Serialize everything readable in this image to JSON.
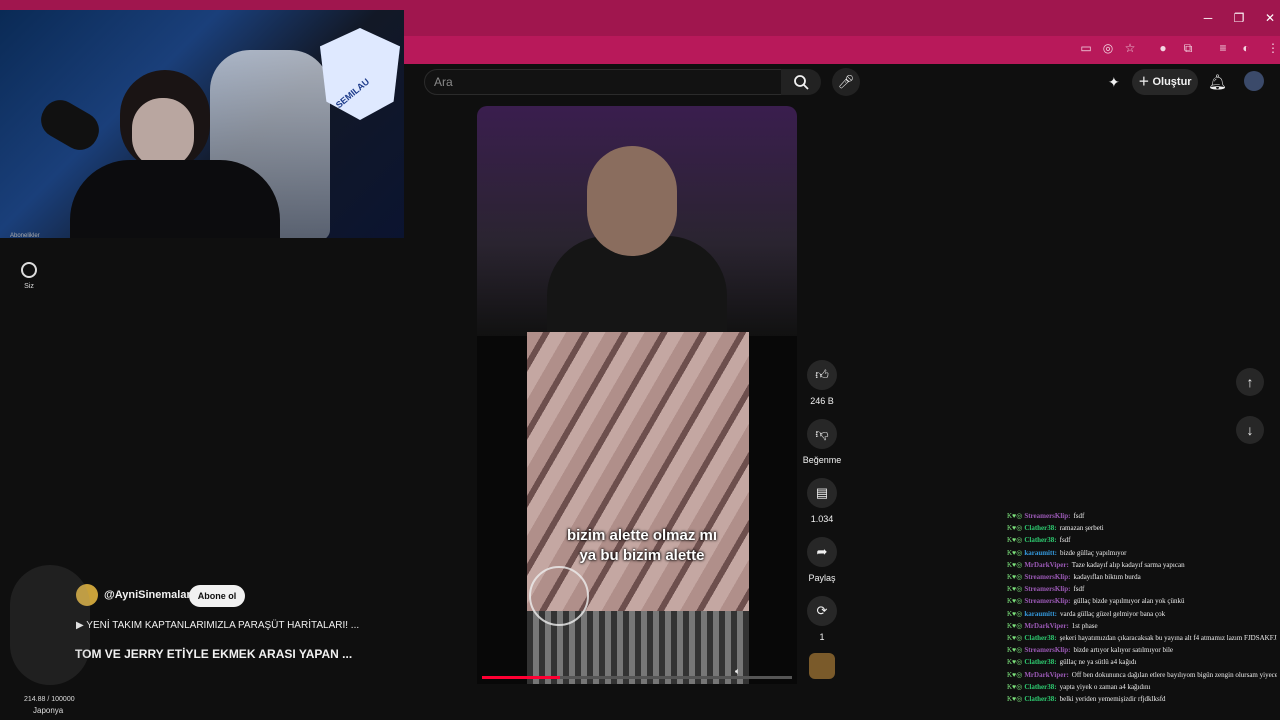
{
  "window": {
    "minimize": "─",
    "restore": "❐",
    "close": "✕"
  },
  "webcam": {
    "logo_text": "SEMILAU"
  },
  "sidebar": {
    "top_label": "Abonelikler",
    "you_label": "Siz"
  },
  "header": {
    "search_placeholder": "Ara",
    "create_label": "Oluştur"
  },
  "video": {
    "caption_line1": "bizim alette olmaz mı",
    "caption_line2": "ya bu bizim alette",
    "progress_pct": 25
  },
  "actions": {
    "likes": "246 B",
    "dislike_label": "Beğenme",
    "comments": "1.034",
    "share_label": "Paylaş",
    "remix_count": "1"
  },
  "channel": {
    "handle": "@AyniSinemalar",
    "subscribe_label": "Abone ol",
    "playlist": "YENİ TAKIM KAPTANLARIMIZLA PARAŞÜT HARİTALARI! ...",
    "title": "TOM VE JERRY ETİYLE EKMEK ARASI YAPAN ..."
  },
  "overlay": {
    "counter": "214.88 / 100000",
    "country": "Japonya"
  },
  "chat": [
    {
      "user": "StreamersKlip",
      "color": "#9b59b6",
      "msg": "fsdf"
    },
    {
      "user": "Clather38",
      "color": "#2ecc71",
      "msg": "ramazan şerbeti"
    },
    {
      "user": "Clather38",
      "color": "#2ecc71",
      "msg": "fsdf"
    },
    {
      "user": "karaumitt",
      "color": "#3498db",
      "msg": "bizde güllaç yapılmıyor"
    },
    {
      "user": "MrDarkViper",
      "color": "#9b59b6",
      "msg": "Taze kadayıf alıp kadayıf sarma yapıcan"
    },
    {
      "user": "StreamersKlip",
      "color": "#9b59b6",
      "msg": "kadayıflan biktım burda"
    },
    {
      "user": "StreamersKlip",
      "color": "#9b59b6",
      "msg": "fsdf"
    },
    {
      "user": "StreamersKlip",
      "color": "#9b59b6",
      "msg": "güllaç bizde yapılmıyor alan yok çünkü"
    },
    {
      "user": "karaumitt",
      "color": "#3498db",
      "msg": "varda güllaç güzel gelmiyor bana çok"
    },
    {
      "user": "MrDarkViper",
      "color": "#9b59b6",
      "msg": "1st phase"
    },
    {
      "user": "Clather38",
      "color": "#2ecc71",
      "msg": "şekeri hayatımızdan çıkaracaksak bu yayına alt f4 atmamız lazım FJDSAKFJDSKFJSD"
    },
    {
      "user": "StreamersKlip",
      "color": "#9b59b6",
      "msg": "bizde artıyor kalıyor satılmıyor bile"
    },
    {
      "user": "Clather38",
      "color": "#2ecc71",
      "msg": "güllaç ne ya sütlü a4 kağıdı"
    },
    {
      "user": "MrDarkViper",
      "color": "#9b59b6",
      "msg": "Off ben dokununca dağılan etlere bayılıyom bigün zengin olursam yiyecem"
    },
    {
      "user": "Clather38",
      "color": "#2ecc71",
      "msg": "yapta yiyek o zaman a4 kağıdını"
    },
    {
      "user": "Clather38",
      "color": "#2ecc71",
      "msg": "belki yeriden yememişizdir rfjdklksfd"
    }
  ]
}
